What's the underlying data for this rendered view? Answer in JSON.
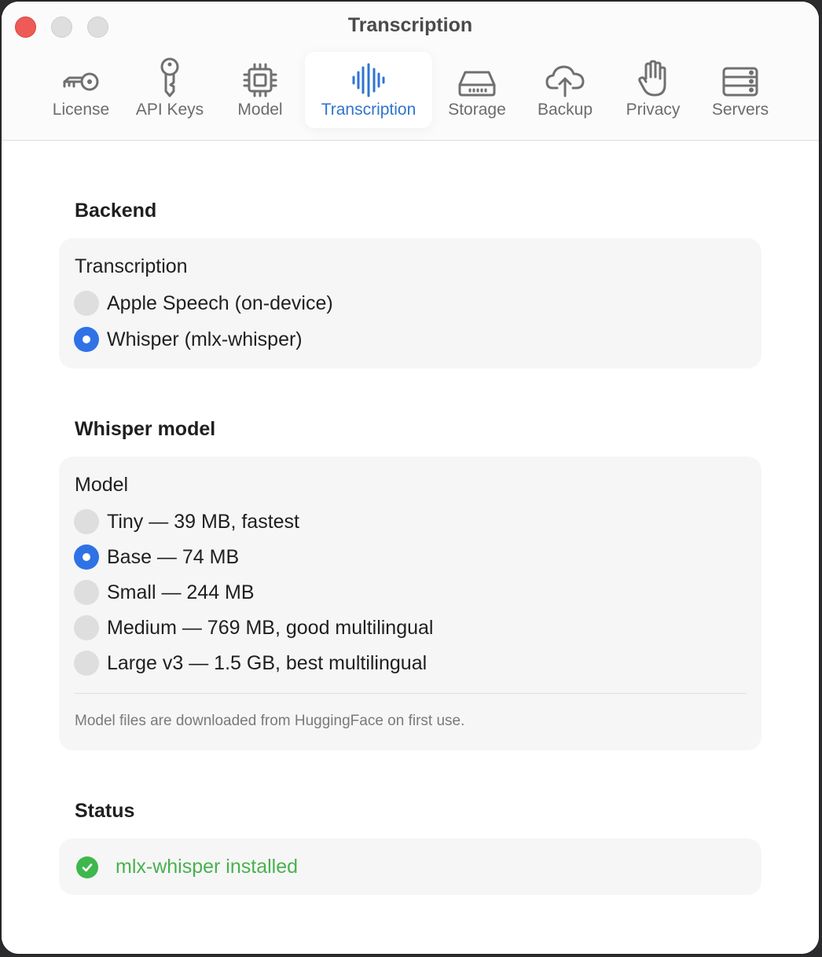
{
  "window": {
    "title": "Transcription"
  },
  "tabs": [
    {
      "label": "License",
      "icon": "key-icon",
      "active": false
    },
    {
      "label": "API Keys",
      "icon": "key-icon",
      "active": false
    },
    {
      "label": "Model",
      "icon": "cpu-chip-icon",
      "active": false
    },
    {
      "label": "Transcription",
      "icon": "waveform-icon",
      "active": true
    },
    {
      "label": "Storage",
      "icon": "drive-icon",
      "active": false
    },
    {
      "label": "Backup",
      "icon": "cloud-upload-icon",
      "active": false
    },
    {
      "label": "Privacy",
      "icon": "hand-icon",
      "active": false
    },
    {
      "label": "Servers",
      "icon": "server-icon",
      "active": false
    }
  ],
  "backend": {
    "section_title": "Backend",
    "group_label": "Transcription",
    "options": [
      {
        "label": "Apple Speech (on-device)",
        "selected": false
      },
      {
        "label": "Whisper (mlx-whisper)",
        "selected": true
      }
    ]
  },
  "whisper_model": {
    "section_title": "Whisper model",
    "group_label": "Model",
    "options": [
      {
        "label": "Tiny — 39 MB, fastest",
        "selected": false
      },
      {
        "label": "Base — 74 MB",
        "selected": true
      },
      {
        "label": "Small — 244 MB",
        "selected": false
      },
      {
        "label": "Medium — 769 MB, good multilingual",
        "selected": false
      },
      {
        "label": "Large v3 — 1.5 GB, best multilingual",
        "selected": false
      }
    ],
    "note": "Model files are downloaded from HuggingFace on first use."
  },
  "status": {
    "section_title": "Status",
    "text": "mlx-whisper installed",
    "icon": "checkmark-circle-icon"
  },
  "colors": {
    "accent": "#2f74d0",
    "radio_selected": "#2e72e6",
    "success": "#49b14f",
    "close_button": "#ee5b56"
  }
}
